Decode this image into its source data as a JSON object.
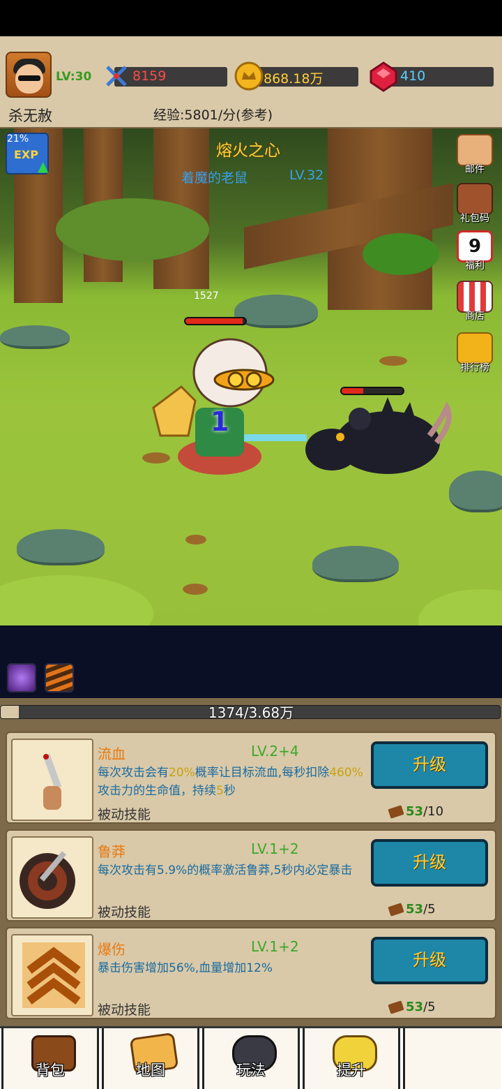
{
  "player": {
    "name": "杀无赦",
    "level": "LV:30",
    "power": "8159",
    "gold": "868.18万",
    "gems": "410",
    "exp_rate": "经验:5801/分(参考)"
  },
  "exp_badge": {
    "percent": "21%",
    "label": "EXP"
  },
  "stage": {
    "title": "熔火之心",
    "monster_name": "着魔的老鼠",
    "monster_level": "LV.32",
    "hero_hp_text": "1527",
    "hero_hp_fraction": 0.95,
    "monster_hp_fraction": 0.35,
    "damage_number": "1"
  },
  "side_menu": [
    {
      "label": "邮件",
      "icon": "mail-icon"
    },
    {
      "label": "礼包码",
      "icon": "gift-chest-icon"
    },
    {
      "label": "福利",
      "icon": "calendar-icon",
      "badge": "9"
    },
    {
      "label": "商店",
      "icon": "shop-icon"
    },
    {
      "label": "排行榜",
      "icon": "trophy-icon"
    }
  ],
  "progress": {
    "text": "1374/3.68万",
    "fraction": 0.037
  },
  "skills": [
    {
      "name": "流血",
      "level": "LV.2+4",
      "desc_parts": [
        "每次攻击会有",
        "20%",
        "概率让目标流血,每秒扣除",
        "460%",
        "攻击力的生命值，持续",
        "5",
        "秒"
      ],
      "type": "被动技能",
      "button": "升级",
      "cost_have": "53",
      "cost_need": "/10"
    },
    {
      "name": "鲁莽",
      "level": "LV.1+2",
      "desc": "每次攻击有5.9%的概率激活鲁莽,5秒内必定暴击",
      "type": "被动技能",
      "button": "升级",
      "cost_have": "53",
      "cost_need": "/5"
    },
    {
      "name": "爆伤",
      "level": "LV.1+2",
      "desc": "暴击伤害增加56%,血量增加12%",
      "type": "被动技能",
      "button": "升级",
      "cost_have": "53",
      "cost_need": "/5"
    }
  ],
  "nav": [
    {
      "label": "背包",
      "icon": "bag-icon"
    },
    {
      "label": "地图",
      "icon": "map-icon"
    },
    {
      "label": "玩法",
      "icon": "gamepad-icon"
    },
    {
      "label": "提升",
      "icon": "fist-icon"
    },
    {
      "label": "",
      "icon": ""
    }
  ],
  "colors": {
    "gold_text": "#ffd23a",
    "level_green": "#3a9a21",
    "skill_blue": "#1a6aa0",
    "button_teal": "#1e87a8"
  }
}
